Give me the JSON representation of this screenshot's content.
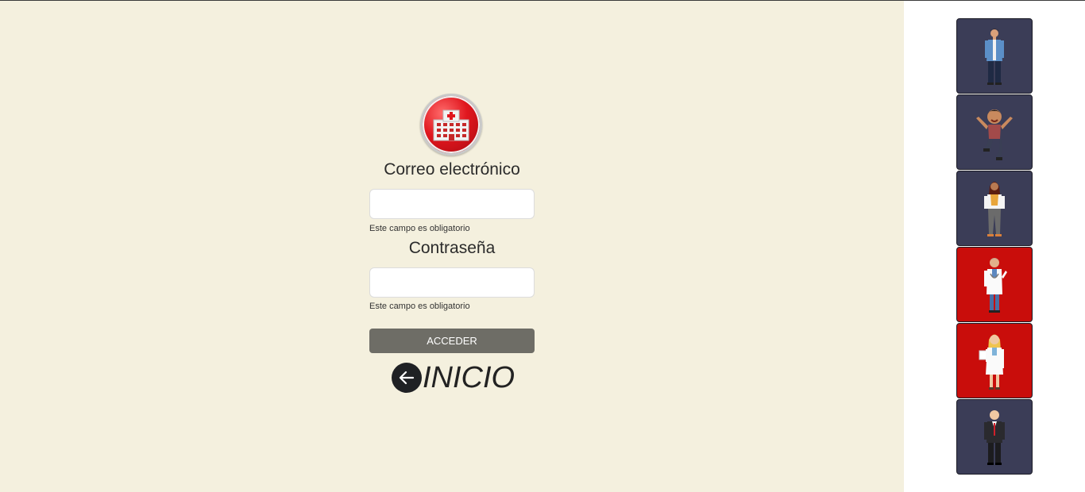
{
  "login": {
    "email_label": "Correo electrónico",
    "email_value": "",
    "email_hint": "Este campo es obligatorio",
    "password_label": "Contraseña",
    "password_value": "",
    "password_hint": "Este campo es obligatorio",
    "submit_label": "ACCEDER",
    "home_label": "INICIO"
  },
  "colors": {
    "background": "#f4f0de",
    "card_dark": "#3b3d57",
    "card_red": "#c90d0b",
    "button": "#6e6d66"
  },
  "avatars": [
    {
      "name": "man-casual-icon",
      "color": "#3b3d57"
    },
    {
      "name": "boy-jumping-icon",
      "color": "#3b3d57"
    },
    {
      "name": "woman-standing-icon",
      "color": "#3b3d57"
    },
    {
      "name": "male-doctor-icon",
      "color": "#c90d0b"
    },
    {
      "name": "female-doctor-icon",
      "color": "#c90d0b"
    },
    {
      "name": "businessman-icon",
      "color": "#3b3d57"
    }
  ]
}
